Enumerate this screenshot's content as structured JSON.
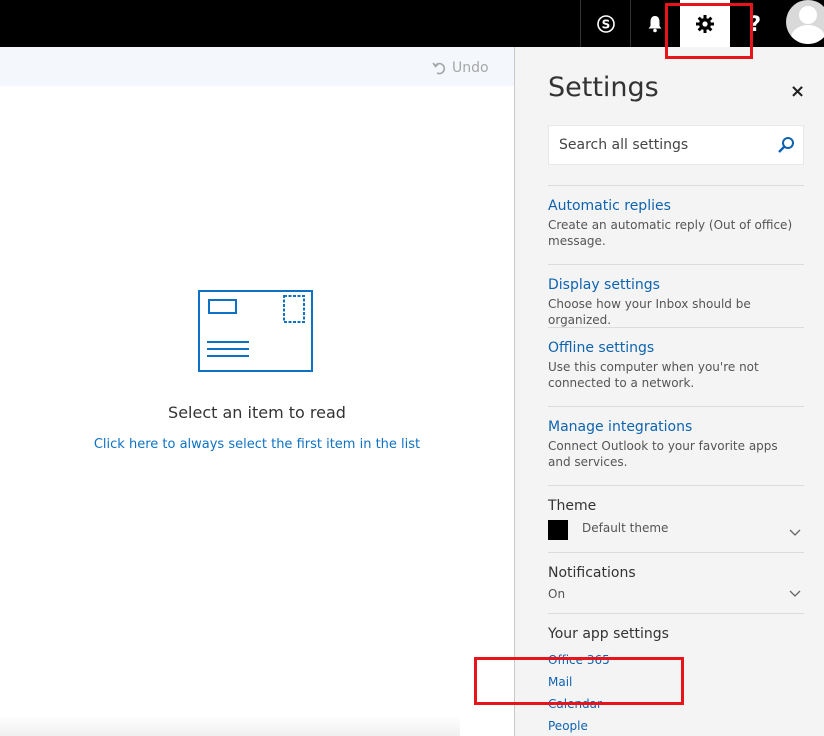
{
  "topbar": {
    "skype_icon": "skype-icon",
    "bell_icon": "bell-icon",
    "gear_icon": "gear-icon",
    "help_label": "?",
    "avatar_icon": "user-avatar-icon"
  },
  "reading": {
    "undo_label": "Undo",
    "title": "Select an item to read",
    "link": "Click here to always select the first item in the list"
  },
  "settings": {
    "title": "Settings",
    "close_label": "×",
    "search_placeholder": "Search all settings",
    "items": [
      {
        "title": "Automatic replies",
        "desc": "Create an automatic reply (Out of office) message."
      },
      {
        "title": "Display settings",
        "desc": "Choose how your Inbox should be organized."
      },
      {
        "title": "Offline settings",
        "desc": "Use this computer when you're not connected to a network."
      },
      {
        "title": "Manage integrations",
        "desc": "Connect Outlook to your favorite apps and services."
      }
    ],
    "theme": {
      "label": "Theme",
      "value": "Default theme",
      "swatch_color": "#000000"
    },
    "notifications": {
      "label": "Notifications",
      "value": "On"
    },
    "app_settings": {
      "label": "Your app settings",
      "links": [
        "Office 365",
        "Mail",
        "Calendar",
        "People"
      ]
    }
  },
  "colors": {
    "accent": "#0e63b0",
    "highlight": "#e8141c"
  }
}
